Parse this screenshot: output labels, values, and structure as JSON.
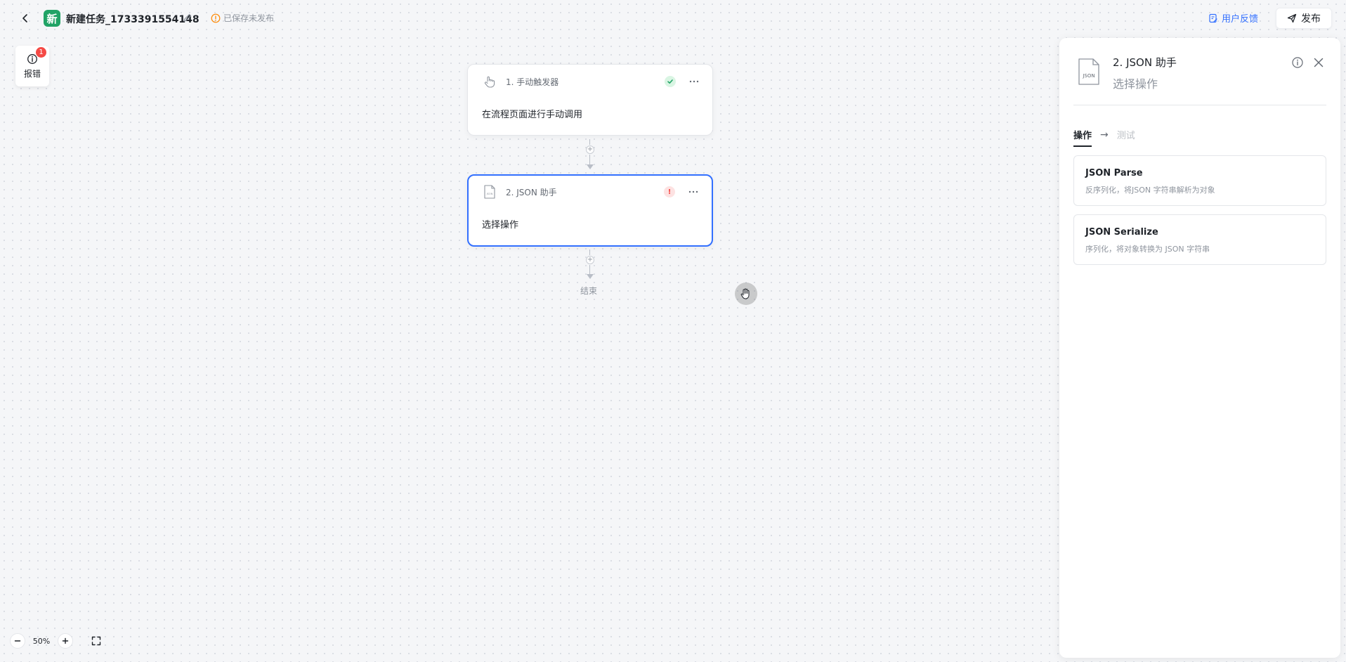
{
  "header": {
    "app_badge": "新",
    "task_title": "新建任务_1733391554148",
    "save_status": "已保存未发布",
    "feedback_label": "用户反馈",
    "publish_label": "发布"
  },
  "error_report": {
    "label": "报错",
    "count": "1"
  },
  "flow": {
    "nodes": [
      {
        "step": "1. 手动触发器",
        "description": "在流程页面进行手动调用",
        "status": "success",
        "icon": "hand-pointer-icon"
      },
      {
        "step": "2. JSON 助手",
        "description": "选择操作",
        "status": "error",
        "icon": "json-file-icon"
      }
    ],
    "end_label": "结束"
  },
  "zoom": {
    "level": "50%"
  },
  "panel": {
    "title": "2. JSON 助手",
    "subtitle": "选择操作",
    "icon_text": "JSON",
    "steps": {
      "active": "操作",
      "inactive": "测试"
    },
    "operations": [
      {
        "name": "JSON Parse",
        "description": "反序列化，将JSON 字符串解析为对象"
      },
      {
        "name": "JSON Serialize",
        "description": "序列化，将对象转换为 JSON 字符串"
      }
    ]
  },
  "colors": {
    "accent": "#3370ff",
    "success": "#21a366",
    "error": "#f54a45"
  }
}
